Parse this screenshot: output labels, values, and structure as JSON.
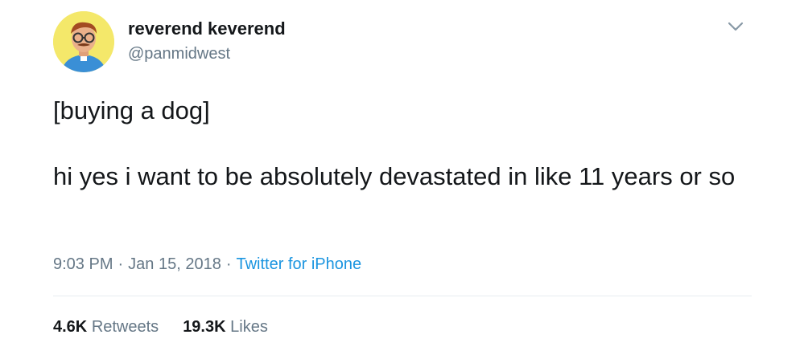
{
  "tweet": {
    "author": {
      "display_name": "reverend keverend",
      "handle": "@panmidwest"
    },
    "text": {
      "line1": "[buying a dog]",
      "line2": "hi yes i want to be absolutely devastated in like 11 years or so"
    },
    "meta": {
      "time": "9:03 PM",
      "separator": "·",
      "date": "Jan 15, 2018",
      "source": "Twitter for iPhone"
    },
    "stats": {
      "retweets_count": "4.6K",
      "retweets_label": "Retweets",
      "likes_count": "19.3K",
      "likes_label": "Likes"
    }
  },
  "icons": {
    "menu": "chevron-down-icon"
  },
  "colors": {
    "text_primary": "#14171a",
    "text_secondary": "#657786",
    "link": "#1b95e0",
    "divider": "#e6ecf0",
    "avatar_bg": "#f4e86a"
  }
}
